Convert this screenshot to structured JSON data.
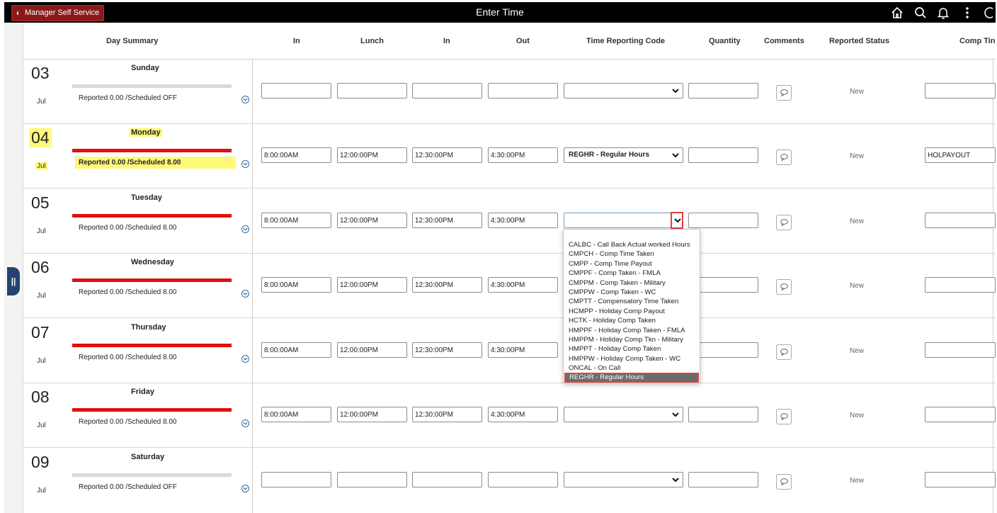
{
  "topbar": {
    "back_label": "Manager Self Service",
    "title": "Enter Time",
    "icons": [
      "home-icon",
      "search-icon",
      "bell-icon",
      "more-icon"
    ]
  },
  "side_tab_label": "||",
  "columns": {
    "day_summary": "Day Summary",
    "in1": "In",
    "lunch": "Lunch",
    "in2": "In",
    "out": "Out",
    "trc": "Time Reporting Code",
    "quantity": "Quantity",
    "comments": "Comments",
    "reported_status": "Reported Status",
    "comp_time": "Comp Tin"
  },
  "days": [
    {
      "num": "03",
      "month": "Jul",
      "weekday": "Sunday",
      "reported": "Reported 0.00 /Scheduled OFF",
      "bar": "gray",
      "in1": "",
      "lunch": "",
      "in2": "",
      "out": "",
      "trc": "",
      "status": "New",
      "comp": ""
    },
    {
      "num": "04",
      "month": "Jul",
      "weekday": "Monday",
      "reported": "Reported 0.00 /Scheduled 8.00",
      "bar": "red",
      "in1": "8:00:00AM",
      "lunch": "12:00:00PM",
      "in2": "12:30:00PM",
      "out": "4:30:00PM",
      "trc": "REGHR - Regular Hours",
      "status": "New",
      "comp": "HOLPAYOUT"
    },
    {
      "num": "05",
      "month": "Jul",
      "weekday": "Tuesday",
      "reported": "Reported 0.00 /Scheduled 8.00",
      "bar": "red",
      "in1": "8:00:00AM",
      "lunch": "12:00:00PM",
      "in2": "12:30:00PM",
      "out": "4:30:00PM",
      "trc": "",
      "status": "New",
      "comp": ""
    },
    {
      "num": "06",
      "month": "Jul",
      "weekday": "Wednesday",
      "reported": "Reported 0.00 /Scheduled 8.00",
      "bar": "red",
      "in1": "8:00:00AM",
      "lunch": "12:00:00PM",
      "in2": "12:30:00PM",
      "out": "4:30:00PM",
      "trc": "",
      "status": "New",
      "comp": ""
    },
    {
      "num": "07",
      "month": "Jul",
      "weekday": "Thursday",
      "reported": "Reported 0.00 /Scheduled 8.00",
      "bar": "red",
      "in1": "8:00:00AM",
      "lunch": "12:00:00PM",
      "in2": "12:30:00PM",
      "out": "4:30:00PM",
      "trc": "",
      "status": "New",
      "comp": ""
    },
    {
      "num": "08",
      "month": "Jul",
      "weekday": "Friday",
      "reported": "Reported 0.00 /Scheduled 8.00",
      "bar": "red",
      "in1": "8:00:00AM",
      "lunch": "12:00:00PM",
      "in2": "12:30:00PM",
      "out": "4:30:00PM",
      "trc": "",
      "status": "New",
      "comp": ""
    },
    {
      "num": "09",
      "month": "Jul",
      "weekday": "Saturday",
      "reported": "Reported 0.00 /Scheduled OFF",
      "bar": "gray",
      "in1": "",
      "lunch": "",
      "in2": "",
      "out": "",
      "trc": "",
      "status": "New",
      "comp": ""
    }
  ],
  "dropdown_options": [
    "CALBC - Call Back Actual worked Hours",
    "CMPCH - Comp Time Taken",
    "CMPP - Comp Time Payout",
    "CMPPF - Comp Taken - FMLA",
    "CMPPM - Comp Taken - Military",
    "CMPPW - Comp Taken - WC",
    "CMPTT - Compensatory Time Taken",
    "HCMPP - Holiday Comp Payout",
    "HCTK - Holiday Comp Taken",
    "HMPPF - Holiday Comp Taken - FMLA",
    "HMPPM - Holiday Comp Tkn - Military",
    "HMPPT - Holiday Comp Taken",
    "HMPPW - Holiday Comp Taken - WC",
    "ONCAL - On Call",
    "REGHR - Regular Hours"
  ],
  "dropdown_selected": "REGHR - Regular Hours",
  "colors": {
    "topbar": "#000000",
    "back_button": "#8a1a1a",
    "status_red": "#e01010",
    "highlight": "#fff979",
    "focus_outline": "#e04040"
  }
}
